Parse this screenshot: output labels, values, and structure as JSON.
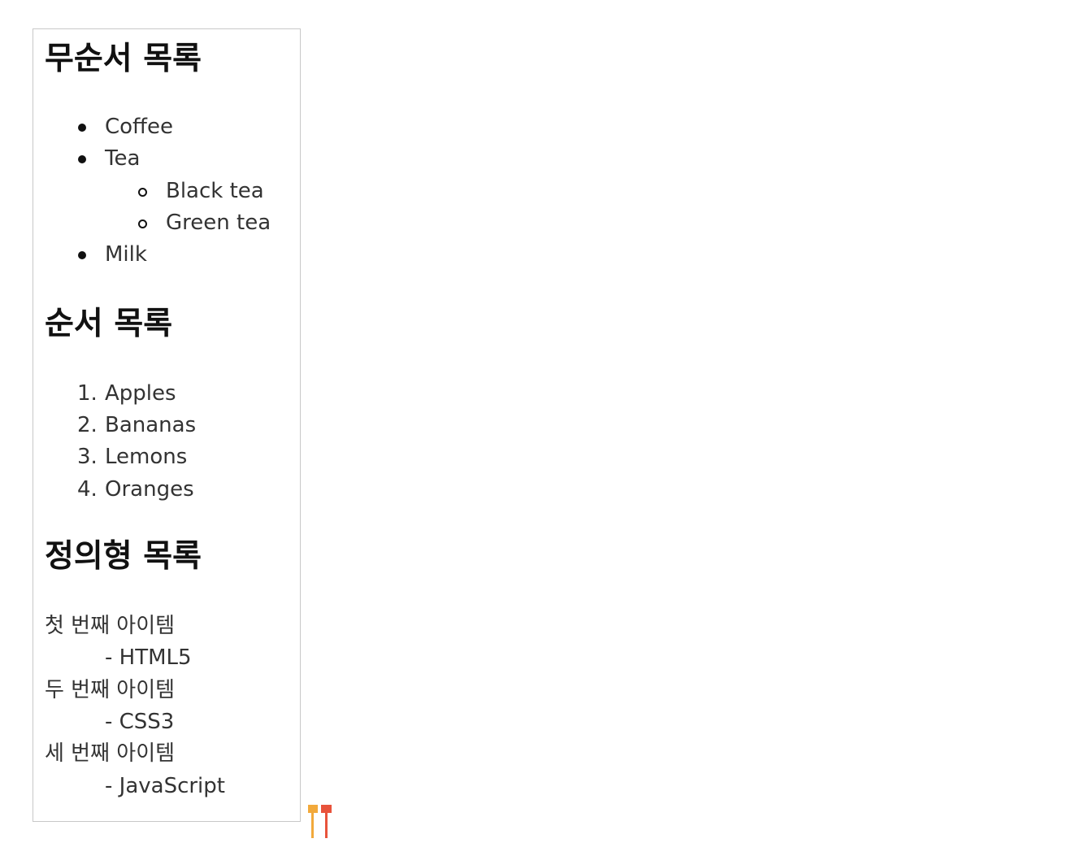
{
  "unordered": {
    "heading": "무순서 목록",
    "items": [
      {
        "label": "Coffee"
      },
      {
        "label": "Tea",
        "children": [
          "Black tea",
          "Green tea"
        ]
      },
      {
        "label": "Milk"
      }
    ]
  },
  "ordered": {
    "heading": "순서 목록",
    "items": [
      {
        "num": "1.",
        "label": "Apples"
      },
      {
        "num": "2.",
        "label": "Bananas"
      },
      {
        "num": "3.",
        "label": "Lemons"
      },
      {
        "num": "4.",
        "label": "Oranges"
      }
    ]
  },
  "definition": {
    "heading": "정의형 목록",
    "items": [
      {
        "term": "첫 번째 아이템",
        "desc": "- HTML5"
      },
      {
        "term": "두 번째 아이템",
        "desc": "- CSS3"
      },
      {
        "term": "세 번째 아이템",
        "desc": "- JavaScript"
      }
    ]
  },
  "icons": {
    "corner_badge": "tt-badge-icon"
  },
  "colors": {
    "badge_left": "#f2a93b",
    "badge_right": "#e8533b"
  }
}
